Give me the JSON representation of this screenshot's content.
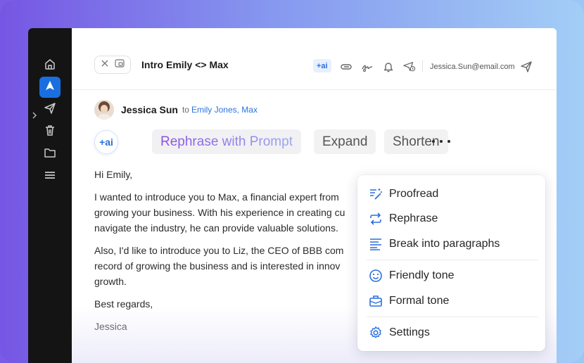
{
  "window": {
    "subject": "Intro Emily <> Max",
    "ai_chip": "+ai",
    "account_email": "Jessica.Sun@email.com"
  },
  "sidebar": {
    "items": [
      {
        "icon": "home-icon"
      },
      {
        "icon": "compose-icon",
        "active": true
      },
      {
        "icon": "send-icon"
      },
      {
        "icon": "trash-icon"
      },
      {
        "icon": "folder-icon"
      },
      {
        "icon": "menu-icon"
      }
    ]
  },
  "message": {
    "sender": "Jessica Sun",
    "to_label": "to",
    "recipients": "Emily Jones, Max",
    "ai_button": "+ai",
    "actions": {
      "rephrase_prompt": "Rephrase with Prompt",
      "expand": "Expand",
      "shorten": "Shorten"
    },
    "paragraphs": [
      [
        "Hi Emily,"
      ],
      [
        "I wanted to introduce you to Max, a financial expert from",
        "growing your business. With his experience in creating cu",
        "navigate the industry, he can provide valuable solutions."
      ],
      [
        "Also, I'd like to introduce you to Liz, the CEO of BBB com",
        "record of growing the business and is interested in innov",
        "growth."
      ],
      [
        "Best regards,"
      ],
      [
        "Jessica"
      ]
    ]
  },
  "menu": {
    "items": [
      {
        "label": "Proofread",
        "icon": "magic-wand-icon"
      },
      {
        "label": "Rephrase",
        "icon": "repeat-icon"
      },
      {
        "label": "Break into paragraphs",
        "icon": "paragraph-lines-icon"
      },
      {
        "label": "Friendly tone",
        "icon": "smiley-icon"
      },
      {
        "label": "Formal tone",
        "icon": "briefcase-icon"
      },
      {
        "label": "Settings",
        "icon": "gear-icon"
      }
    ]
  },
  "colors": {
    "accent": "#2a6fe0",
    "sidebar_bg": "#141414",
    "active_nav": "#1a6fe0"
  }
}
